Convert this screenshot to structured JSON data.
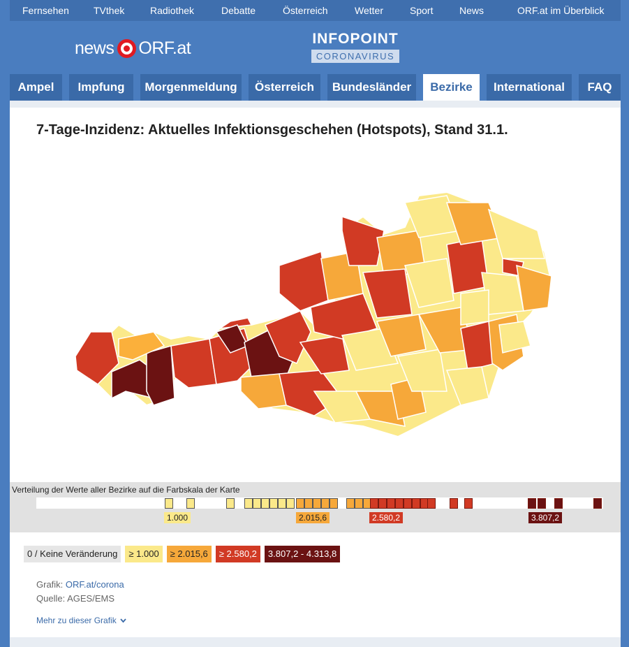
{
  "top_nav": [
    "Fernsehen",
    "TVthek",
    "Radiothek",
    "Debatte",
    "Österreich",
    "Wetter",
    "Sport",
    "News",
    "ORF.at im Überblick"
  ],
  "logo": {
    "news": "news",
    "orf": "ORF.at"
  },
  "infopoint": {
    "title": "INFOPOINT",
    "subtitle": "CORONAVIRUS"
  },
  "tabs": [
    "Ampel",
    "Impfung",
    "Morgenmeldung",
    "Österreich",
    "Bundesländer",
    "Bezirke",
    "International",
    "FAQ"
  ],
  "active_tab": "Bezirke",
  "heading": "7-Tage-Inzidenz: Aktuelles Infektionsgeschehen (Hotspots), Stand 31.1.",
  "distribution": {
    "label": "Verteilung der Werte aller Bezirke auf die Farbskala der Karte",
    "thresholds": [
      "1.000",
      "2.015,6",
      "2.580,2",
      "3.807,2"
    ]
  },
  "legend": [
    "0 / Keine Veränderung",
    "≥ 1.000",
    "≥ 2.015,6",
    "≥ 2.580,2",
    "3.807,2 - 4.313,8"
  ],
  "colors": {
    "c0": "#e6e6e6",
    "c1": "#fbe98a",
    "c2": "#f6a83a",
    "c3": "#d13a24",
    "c4": "#6b1212"
  },
  "credits": {
    "grafik_label": "Grafik:",
    "grafik_link": "ORF.at/corona",
    "quelle": "Quelle: AGES/EMS"
  },
  "more_link": "Mehr zu dieser Grafik"
}
